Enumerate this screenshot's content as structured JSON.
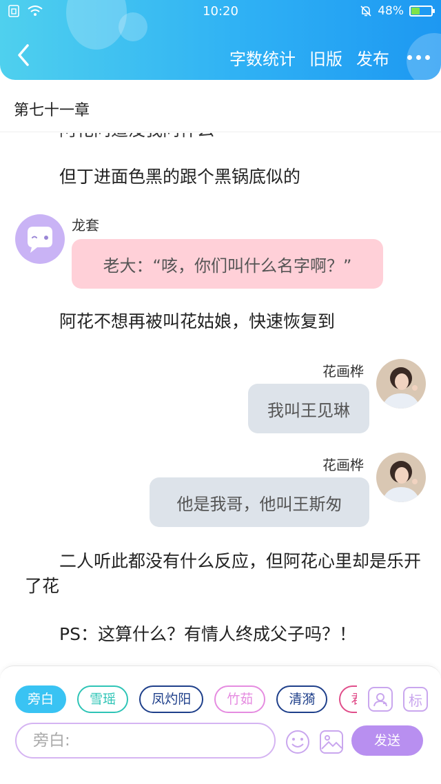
{
  "status": {
    "time": "10:20",
    "battery": "48%",
    "battery_level": 0.48
  },
  "header": {
    "actions": [
      "字数统计",
      "旧版",
      "发布"
    ],
    "back_icon": "chevron-left-icon",
    "more_icon": "more-dots-icon",
    "gradient": [
      "#4fd0ee",
      "#1d98f2"
    ]
  },
  "chapter": {
    "title": "第七十一章"
  },
  "content": {
    "partial_top": "阿花问道没我问什么",
    "para1": "但丁进面色黑的跟个黑锅底似的",
    "msg1": {
      "speaker": "龙套",
      "text": "老大：“咳，你们叫什么名字啊？”"
    },
    "para2": "阿花不想再被叫花姑娘，快速恢复到",
    "msg2": {
      "speaker": "花画桦",
      "text": "我叫王见琳"
    },
    "msg3": {
      "speaker": "花画桦",
      "text": "他是我哥，他叫王斯匆"
    },
    "para3": "二人听此都没有什么反应，但阿花心里却是乐开了花",
    "para4": "PS：这算什么？有情人终成父子吗？！"
  },
  "roles": [
    {
      "name": "旁白",
      "color": "#39c3f3",
      "active": true
    },
    {
      "name": "雪瑶",
      "color": "#2ec4b6",
      "active": false
    },
    {
      "name": "凤灼阳",
      "color": "#1e3f8a",
      "active": false
    },
    {
      "name": "竹茹",
      "color": "#e58be0",
      "active": false
    },
    {
      "name": "清漪",
      "color": "#1e3f8a",
      "active": false
    },
    {
      "name": "君",
      "color": "#e04d8a",
      "active": false
    }
  ],
  "input": {
    "placeholder": "旁白:",
    "send_label": "发送",
    "mark_label": "标"
  }
}
